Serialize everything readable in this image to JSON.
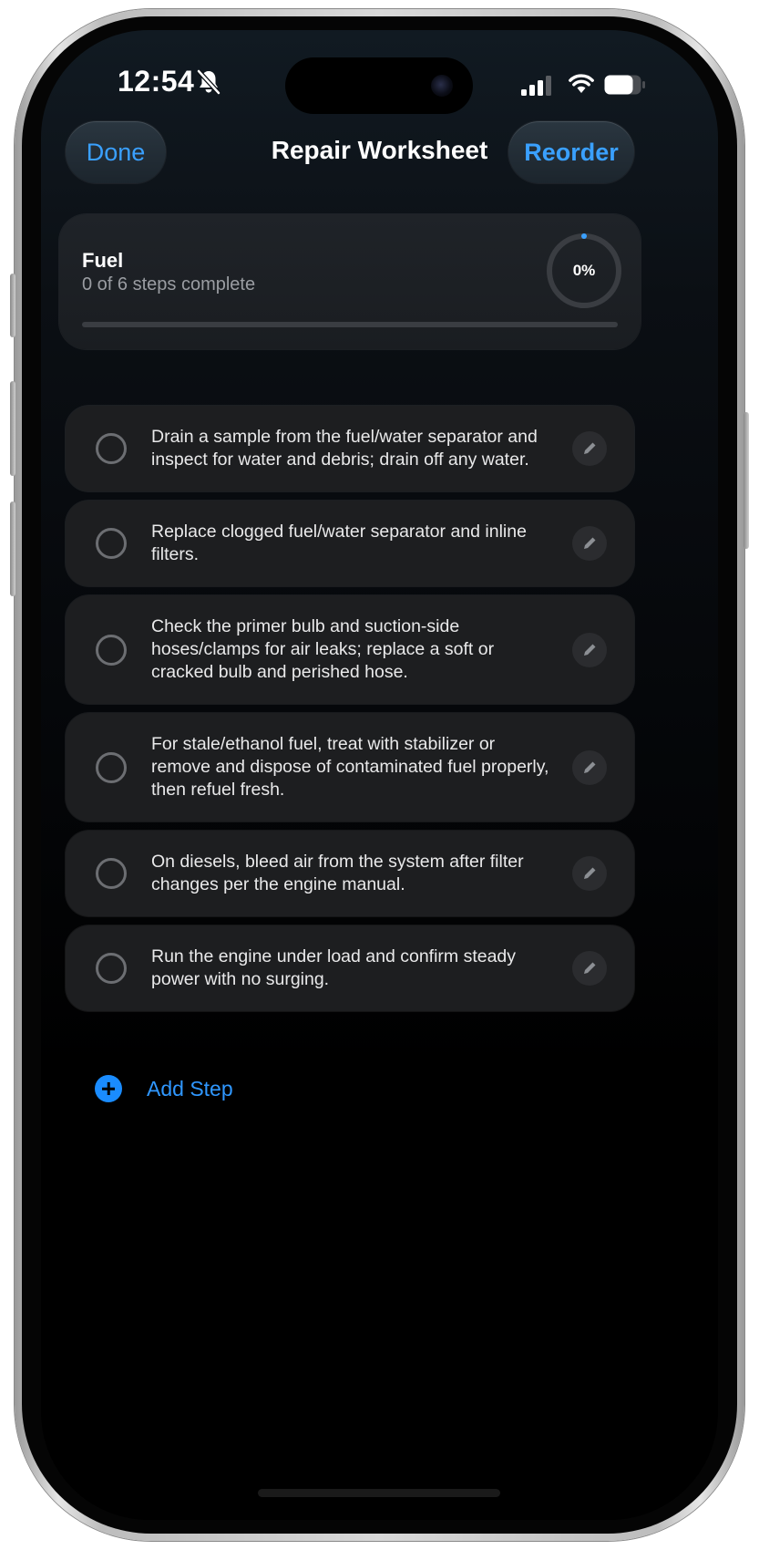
{
  "status_bar": {
    "time": "12:54",
    "icons": [
      "bell-slash-icon",
      "cellular-signal-icon",
      "wifi-icon",
      "battery-icon"
    ]
  },
  "nav": {
    "done_label": "Done",
    "title": "Repair Worksheet",
    "reorder_label": "Reorder"
  },
  "summary": {
    "title": "Fuel",
    "subtitle": "0 of 6 steps complete",
    "progress_label": "0%",
    "progress_fraction": 0
  },
  "steps": [
    {
      "text": "Drain a sample from the fuel/water separator and inspect for water and debris; drain off any water.",
      "completed": false
    },
    {
      "text": "Replace clogged fuel/water separator and inline filters.",
      "completed": false
    },
    {
      "text": "Check the primer bulb and suction-side hoses/clamps for air leaks; replace a soft or cracked bulb and perished hose.",
      "completed": false
    },
    {
      "text": "For stale/ethanol fuel, treat with stabilizer or remove and dispose of contaminated fuel properly, then refuel fresh.",
      "completed": false
    },
    {
      "text": "On diesels, bleed air from the system after filter changes per the engine manual.",
      "completed": false
    },
    {
      "text": "Run the engine under load and confirm steady power with no surging.",
      "completed": false
    }
  ],
  "add_step_label": "Add Step",
  "colors": {
    "accent": "#3aa0ff",
    "card_background": "#1d1e20",
    "screen_background": "#000000"
  }
}
